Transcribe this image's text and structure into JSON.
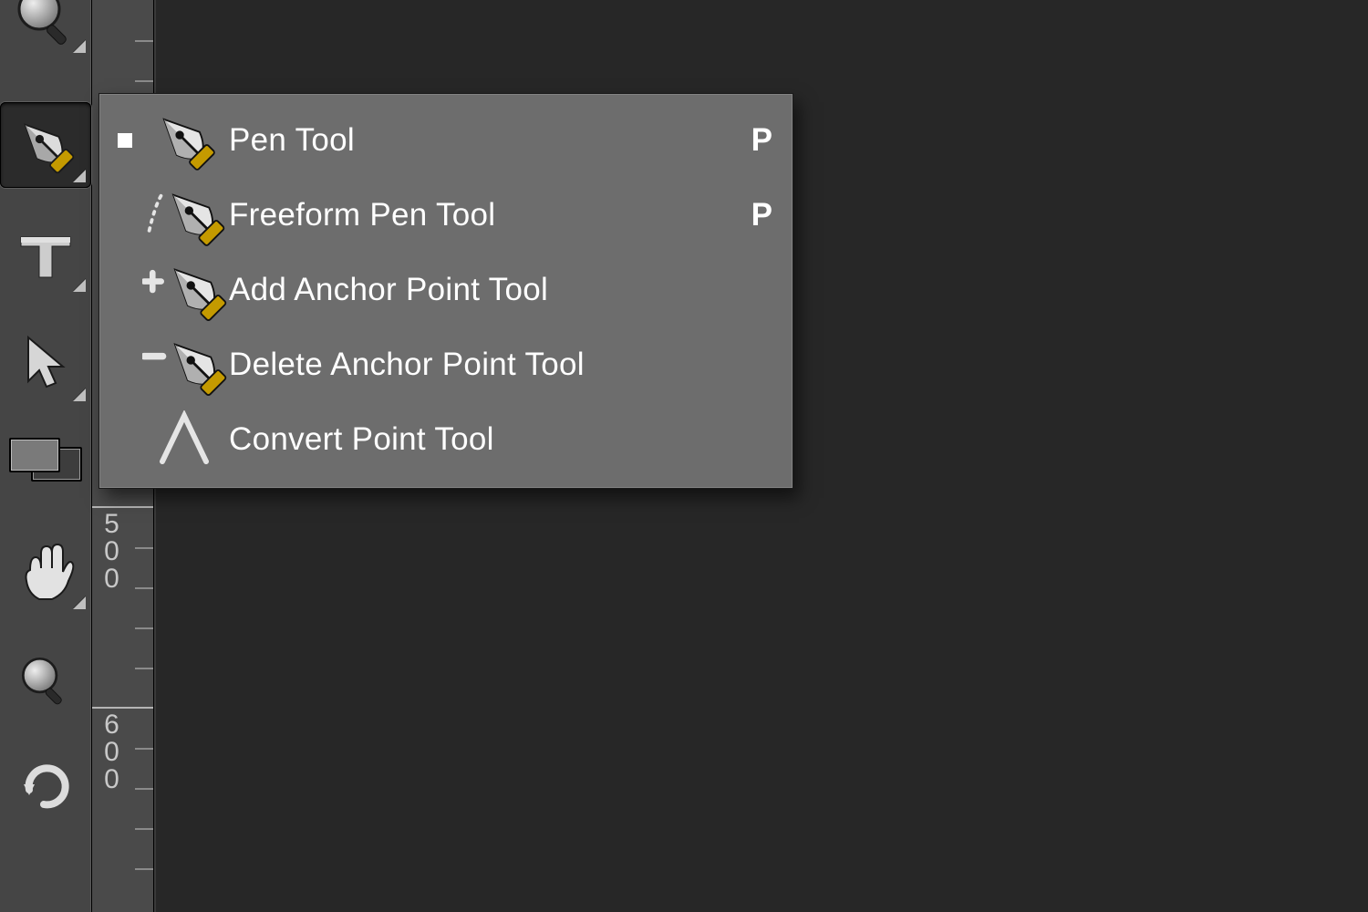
{
  "tools": {
    "magnifier": {
      "name": "magnifier-tool"
    },
    "pen_selected": {
      "name": "pen-tool"
    },
    "type": {
      "name": "type-tool"
    },
    "arrow": {
      "name": "path-selection-tool"
    },
    "swatch": {
      "name": "color-swatch"
    },
    "hand": {
      "name": "hand-tool"
    },
    "zoom": {
      "name": "zoom-tool"
    },
    "rotate": {
      "name": "rotate-view-tool"
    }
  },
  "ruler": {
    "label_500": "500",
    "label_600": "600"
  },
  "flyout": {
    "items": [
      {
        "label": "Pen Tool",
        "shortcut": "P",
        "selected": true,
        "icon": "pen-nib-icon"
      },
      {
        "label": "Freeform Pen Tool",
        "shortcut": "P",
        "selected": false,
        "icon": "freeform-pen-icon"
      },
      {
        "label": "Add Anchor Point Tool",
        "shortcut": "",
        "selected": false,
        "icon": "add-anchor-icon"
      },
      {
        "label": "Delete Anchor Point Tool",
        "shortcut": "",
        "selected": false,
        "icon": "delete-anchor-icon"
      },
      {
        "label": "Convert Point Tool",
        "shortcut": "",
        "selected": false,
        "icon": "convert-point-icon"
      }
    ]
  }
}
